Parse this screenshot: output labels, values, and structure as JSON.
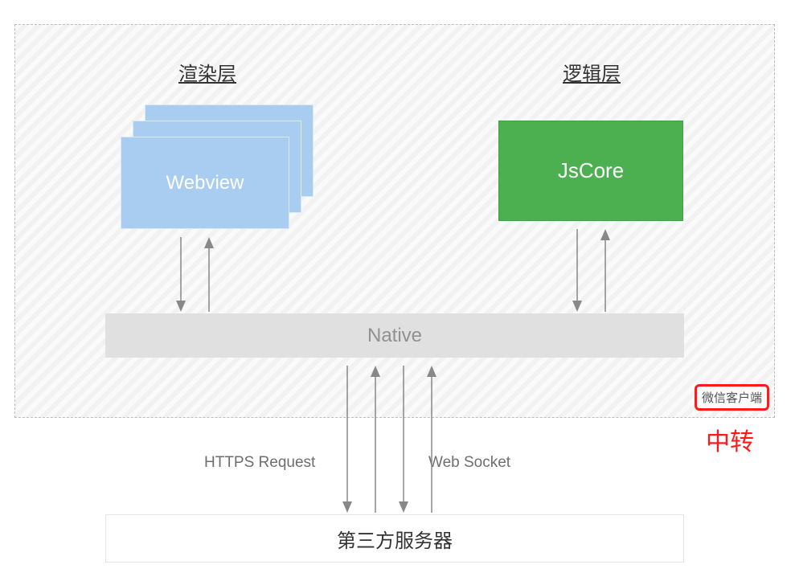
{
  "render_layer_title": "渲染层",
  "logic_layer_title": "逻辑层",
  "webview_label": "Webview",
  "jscore_label": "JsCore",
  "native_label": "Native",
  "https_label": "HTTPS Request",
  "websocket_label": "Web Socket",
  "server_label": "第三方服务器",
  "annotation_box": "微信客户端",
  "annotation_text": "中转"
}
